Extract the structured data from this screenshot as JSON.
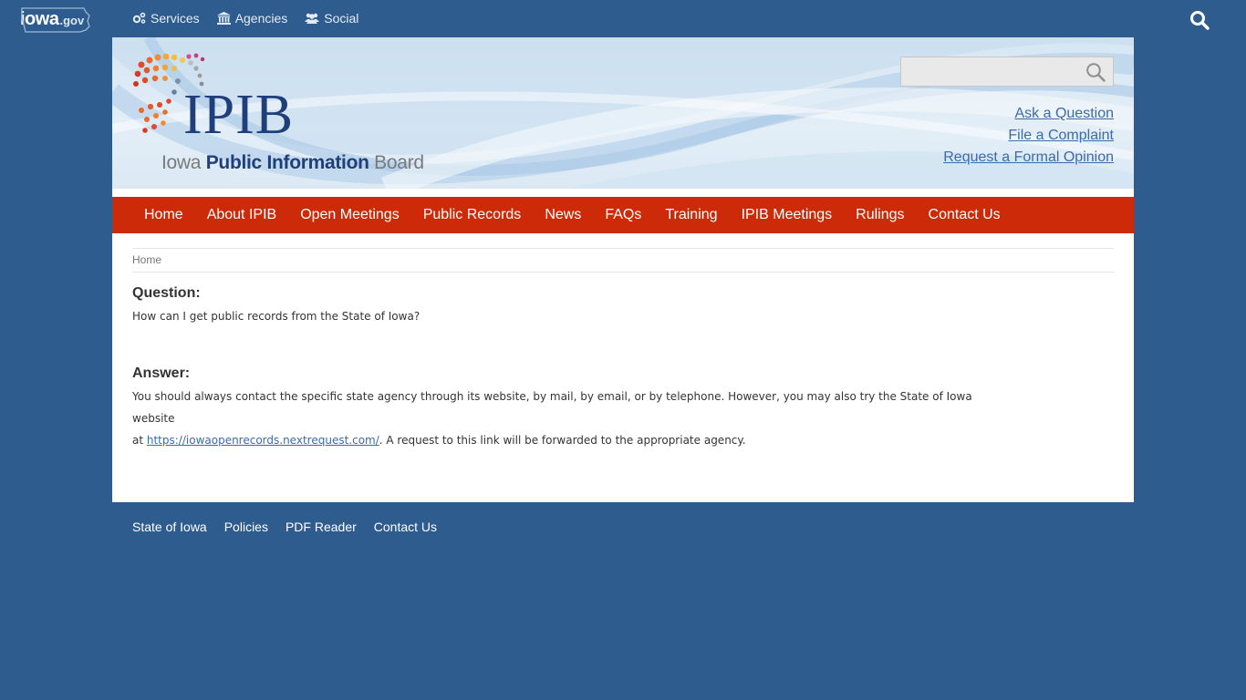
{
  "topbar": {
    "logo_word": "iowa",
    "logo_suffix": ".gov",
    "nav": [
      {
        "label": "Services",
        "icon": "gears-icon"
      },
      {
        "label": "Agencies",
        "icon": "building-icon"
      },
      {
        "label": "Social",
        "icon": "users-icon"
      }
    ]
  },
  "banner": {
    "logo_title": "IPIB",
    "logo_sub_1": "Iowa ",
    "logo_sub_2": "Public Information",
    "logo_sub_3": " Board",
    "search_placeholder": "",
    "quick_links": [
      "Ask a Question",
      "File a Complaint",
      "Request a Formal Opinion"
    ]
  },
  "mainnav": [
    "Home",
    "About IPIB",
    "Open Meetings",
    "Public Records",
    "News",
    "FAQs",
    "Training",
    "IPIB Meetings",
    "Rulings",
    "Contact Us"
  ],
  "breadcrumb": "Home",
  "content": {
    "question_heading": "Question:",
    "question_text": "How can I get public records from the State of Iowa?",
    "answer_heading": "Answer:",
    "answer_line_1": "You should always contact the specific state agency through its website, by mail, by email, or by telephone.  However, you may also try the State of Iowa website",
    "answer_prefix": "at ",
    "answer_link": "https://iowaopenrecords.nextrequest.com/",
    "answer_suffix": ". A request to this link will be forwarded to the appropriate agency."
  },
  "footer": [
    "State of Iowa",
    "Policies",
    "PDF Reader",
    "Contact Us"
  ],
  "colors": {
    "background": "#2f5c8f",
    "nav_red": "#cc2a08",
    "link_blue": "#3d6aa8",
    "logo_navy": "#1f3f7a"
  }
}
